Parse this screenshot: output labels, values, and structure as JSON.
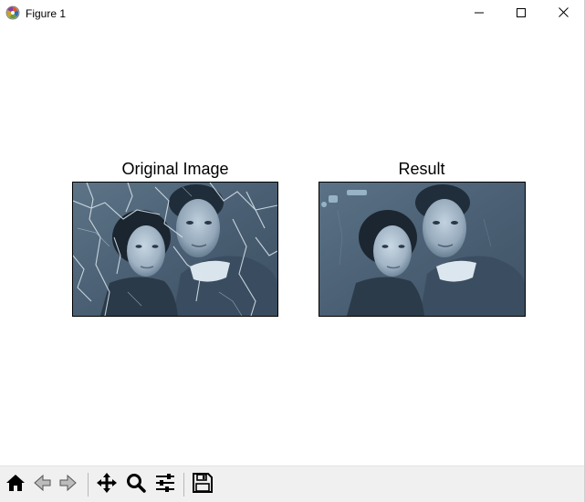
{
  "window": {
    "title": "Figure 1",
    "icons": {
      "app": "matplotlib-logo-icon",
      "minimize": "minimize-icon",
      "maximize": "maximize-icon",
      "close": "close-icon"
    }
  },
  "figure": {
    "axes": [
      {
        "title": "Original Image",
        "image": "damaged vintage portrait photo"
      },
      {
        "title": "Result",
        "image": "restored vintage portrait photo"
      }
    ]
  },
  "toolbar": {
    "buttons": [
      {
        "id": "home",
        "icon": "home-icon"
      },
      {
        "id": "back",
        "icon": "back-arrow-icon"
      },
      {
        "id": "forward",
        "icon": "forward-arrow-icon"
      },
      {
        "id": "pan",
        "icon": "move-icon"
      },
      {
        "id": "zoom",
        "icon": "magnifier-icon"
      },
      {
        "id": "configure",
        "icon": "sliders-icon"
      },
      {
        "id": "save",
        "icon": "save-icon"
      }
    ]
  },
  "colors": {
    "photo_base": "#4f6479",
    "photo_light": "#b9cbd9",
    "photo_dark": "#1e2b38",
    "toolbar_bg": "#f0f0f0"
  }
}
